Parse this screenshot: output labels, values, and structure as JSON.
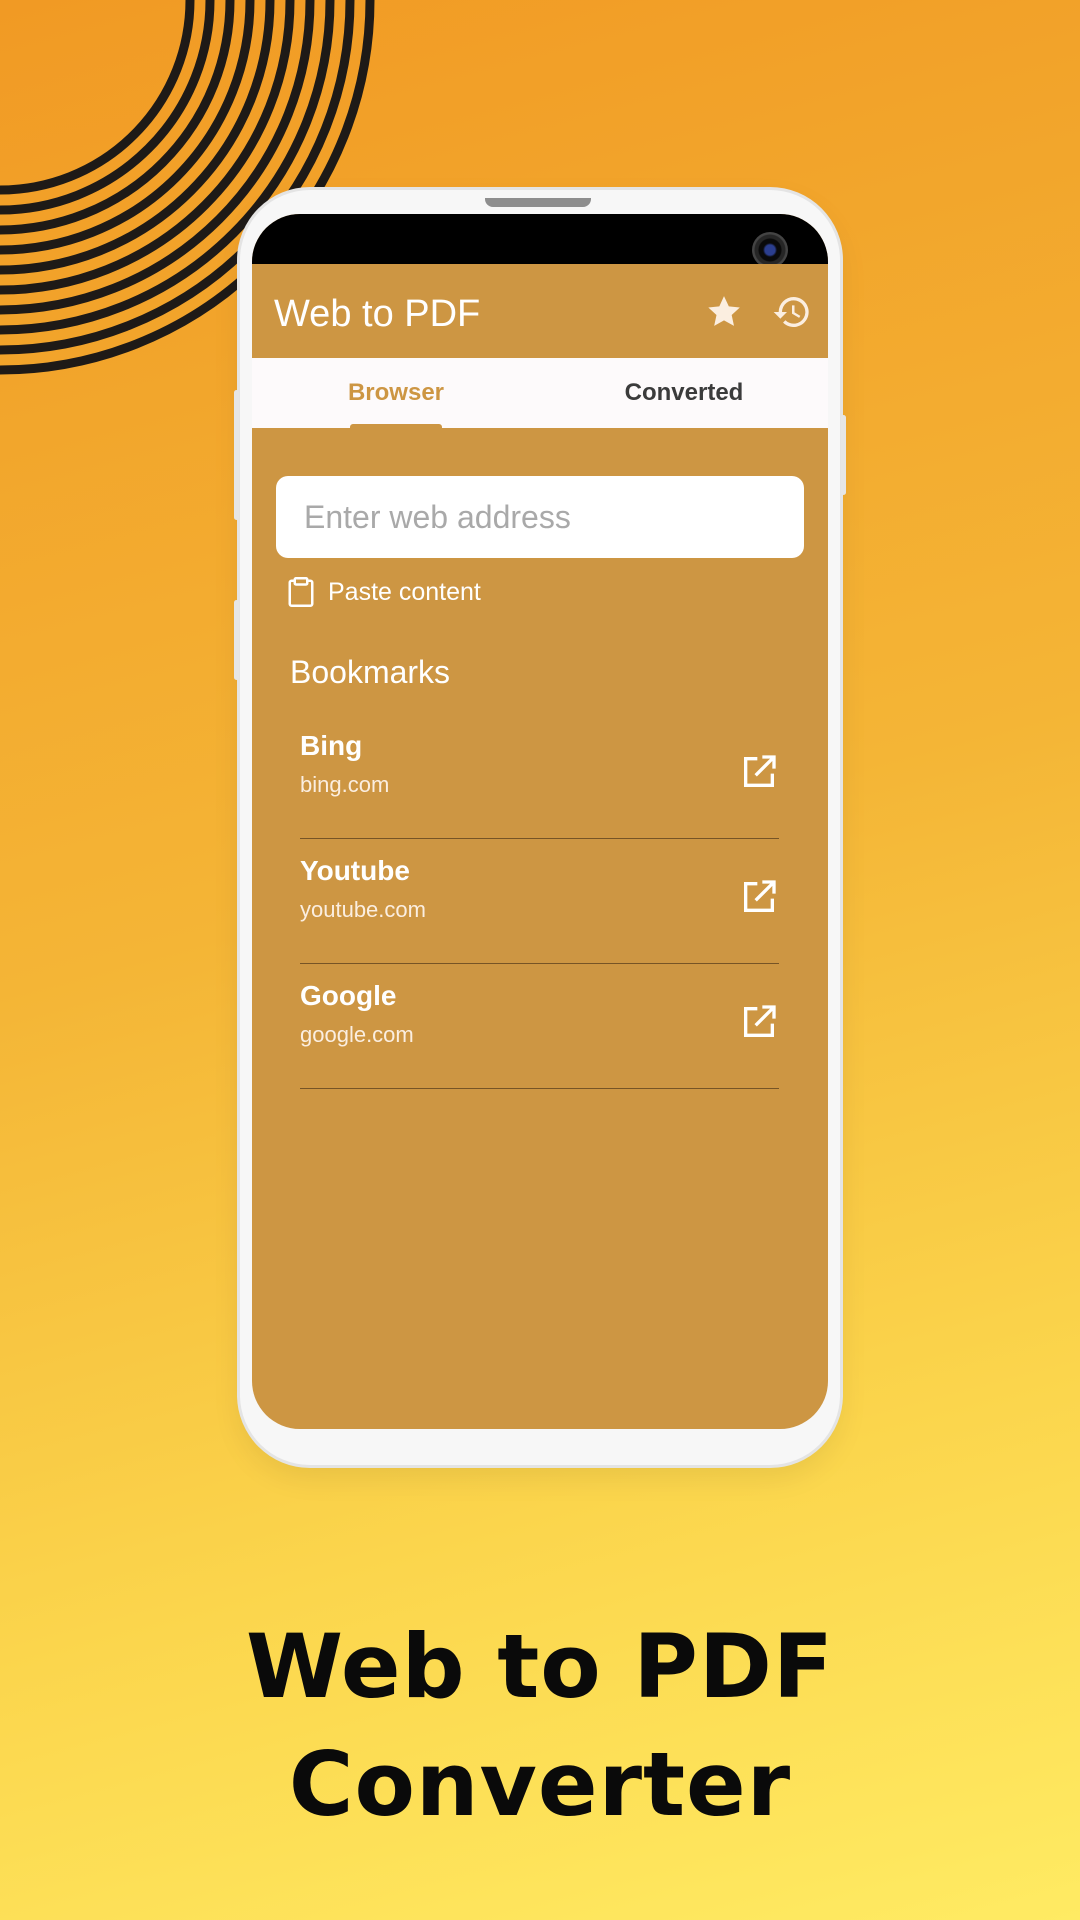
{
  "colors": {
    "accent": "#cd9643",
    "background_top": "#f19a24",
    "background_bottom": "#ffeb63",
    "tab_bar": "#fdfafb",
    "headline": "#0a0a0a"
  },
  "app_bar": {
    "title": "Web to PDF",
    "icons": [
      "star-icon",
      "history-icon"
    ]
  },
  "tabs": [
    {
      "label": "Browser",
      "selected": true
    },
    {
      "label": "Converted",
      "selected": false
    }
  ],
  "address": {
    "placeholder": "Enter web address",
    "value": ""
  },
  "paste": {
    "label": "Paste content",
    "icon": "clipboard-icon"
  },
  "bookmarks": {
    "title": "Bookmarks",
    "items": [
      {
        "name": "Bing",
        "url": "bing.com",
        "icon": "open-external-icon"
      },
      {
        "name": "Youtube",
        "url": "youtube.com",
        "icon": "open-external-icon"
      },
      {
        "name": "Google",
        "url": "google.com",
        "icon": "open-external-icon"
      }
    ]
  },
  "promo": {
    "line1": "Web to PDF",
    "line2": "Converter"
  }
}
